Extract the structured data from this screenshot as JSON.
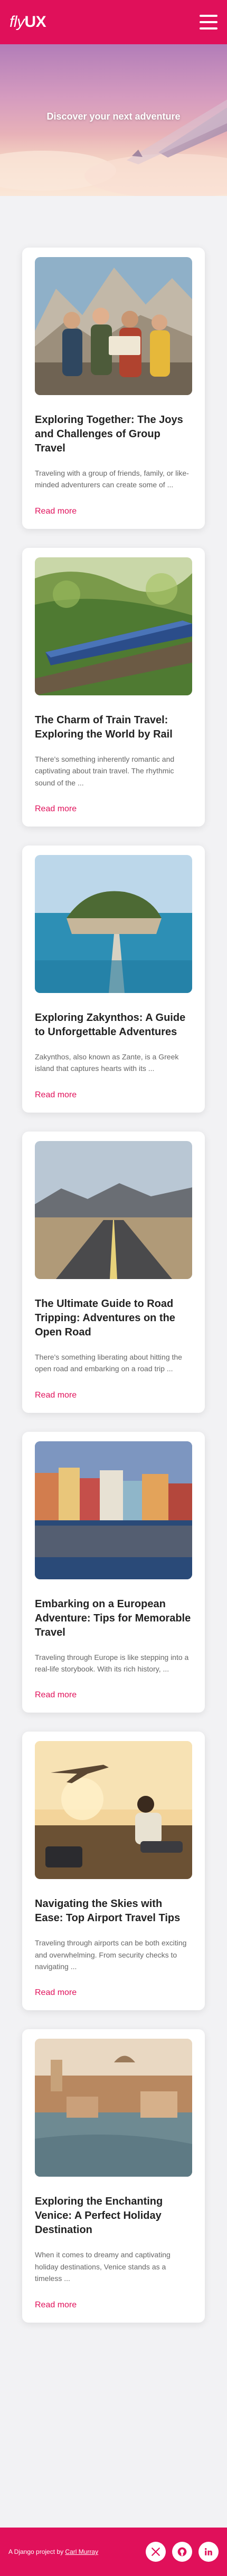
{
  "brand": {
    "logo_fly": "fly",
    "logo_ux": "UX"
  },
  "hero": {
    "title": "Discover your next adventure"
  },
  "posts": [
    {
      "title": "Exploring Together: The Joys and Challenges of Group Travel",
      "excerpt": "Traveling with a group of friends, family, or like-minded adventurers can create some of ...",
      "read_more": "Read more"
    },
    {
      "title": "The Charm of Train Travel: Exploring the World by Rail",
      "excerpt": "There's something inherently romantic and captivating about train travel. The rhythmic sound of the ...",
      "read_more": "Read more"
    },
    {
      "title": "Exploring Zakynthos: A Guide to Unforgettable Adventures",
      "excerpt": "Zakynthos, also known as Zante, is a Greek island that captures hearts with its ...",
      "read_more": "Read more"
    },
    {
      "title": "The Ultimate Guide to Road Tripping: Adventures on the Open Road",
      "excerpt": "There's something liberating about hitting the open road and embarking on a road trip ...",
      "read_more": "Read more"
    },
    {
      "title": "Embarking on a European Adventure: Tips for Memorable Travel",
      "excerpt": "Traveling through Europe is like stepping into a real-life storybook. With its rich history, ...",
      "read_more": "Read more"
    },
    {
      "title": "Navigating the Skies with Ease: Top Airport Travel Tips",
      "excerpt": "Traveling through airports can be both exciting and overwhelming. From security checks to navigating ...",
      "read_more": "Read more"
    },
    {
      "title": "Exploring the Enchanting Venice: A Perfect Holiday Destination",
      "excerpt": "When it comes to dreamy and captivating holiday destinations, Venice stands as a timeless ...",
      "read_more": "Read more"
    }
  ],
  "footer": {
    "text_prefix": "A Django project by ",
    "credit": "Carl Murray",
    "social_icons": [
      "x-twitter-icon",
      "github-icon",
      "linkedin-icon"
    ]
  },
  "colors": {
    "brand": "#e0105a",
    "background": "#f2f2f4",
    "card": "#ffffff"
  }
}
